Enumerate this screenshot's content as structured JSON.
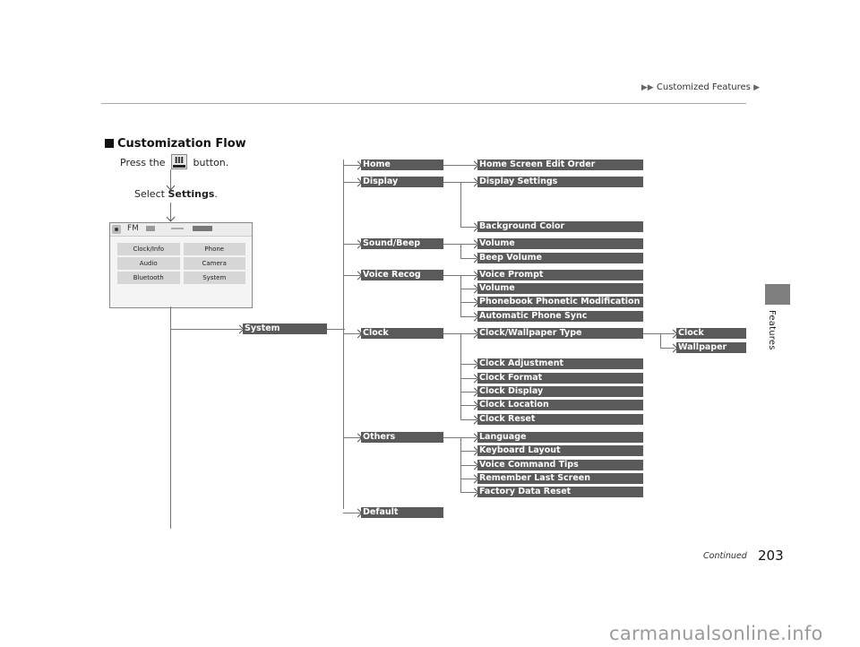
{
  "header": {
    "breadcrumb_prefix": "▶▶",
    "breadcrumb": "Customized Features",
    "breadcrumb_suffix": "▶"
  },
  "side_tab": {
    "label": "Features"
  },
  "section": {
    "title": "Customization Flow"
  },
  "steps": {
    "press_prefix": "Press the",
    "press_button_icon": "home-button-icon",
    "press_suffix": "button.",
    "select_prefix": "Select",
    "select_target": "Settings",
    "select_suffix": "."
  },
  "screen": {
    "status_band": "FM",
    "cells": [
      "Clock/Info",
      "Phone",
      "Audio",
      "Camera",
      "Bluetooth",
      "System"
    ]
  },
  "flow": {
    "root": "System",
    "categories": [
      {
        "label": "Home",
        "children": [
          "Home Screen Edit Order"
        ]
      },
      {
        "label": "Display",
        "children": [
          "Display Settings",
          "Background Color"
        ]
      },
      {
        "label": "Sound/Beep",
        "children": [
          "Volume",
          "Beep Volume"
        ]
      },
      {
        "label": "Voice Recog",
        "children": [
          "Voice Prompt",
          "Volume",
          "Phonebook Phonetic Modification",
          "Automatic Phone Sync"
        ]
      },
      {
        "label": "Clock",
        "children": [
          "Clock/Wallpaper Type",
          "Clock Adjustment",
          "Clock Format",
          "Clock Display",
          "Clock Location",
          "Clock Reset"
        ],
        "grandchildren": [
          "Clock",
          "Wallpaper"
        ]
      },
      {
        "label": "Others",
        "children": [
          "Language",
          "Keyboard Layout",
          "Voice Command Tips",
          "Remember Last Screen",
          "Factory Data Reset"
        ]
      },
      {
        "label": "Default",
        "children": []
      }
    ]
  },
  "footer": {
    "continued": "Continued",
    "page_number": "203"
  },
  "watermark": "carmanualsonline.info",
  "colors": {
    "box_fill": "#5a5a5a",
    "box_text": "#ffffff",
    "side_tab": "#7f7f7f"
  }
}
